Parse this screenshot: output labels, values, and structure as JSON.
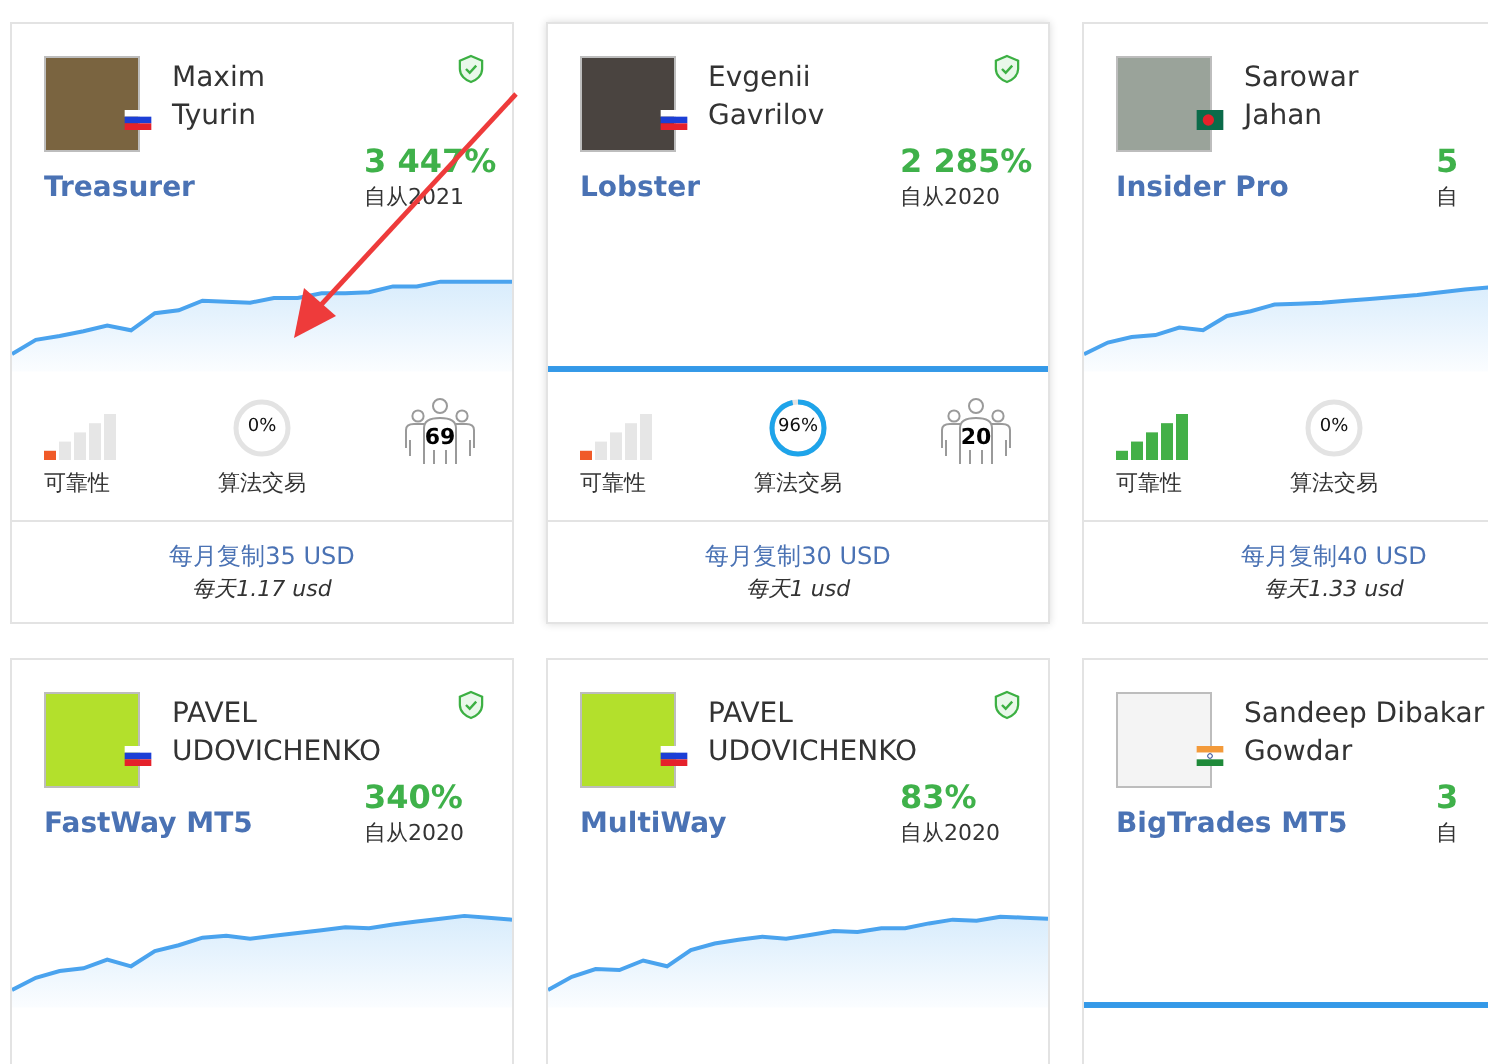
{
  "rows": [
    {
      "cards": [
        {
          "author_lines": [
            "Maxim",
            "Tyurin"
          ],
          "flag": {
            "kind": "ru"
          },
          "avatar": {
            "color": "#7a6440"
          },
          "verified": true,
          "strategy": "Treasurer",
          "gain": "3 447%",
          "since": "自从2021",
          "chart": {
            "kind": "rising"
          },
          "stats": {
            "reliability": {
              "level": 0.2,
              "label": "可靠性"
            },
            "algo": {
              "level": 0,
              "reading": "0%",
              "label": "算法交易"
            },
            "subscribers": "69"
          },
          "price": "每月复制35 USD",
          "daily": "每天1.17 usd"
        },
        {
          "author_lines": [
            "Evgenii",
            "Gavrilov"
          ],
          "flag": {
            "kind": "ru"
          },
          "avatar": {
            "color": "#4a4440"
          },
          "verified": true,
          "strategy": "Lobster",
          "gain": "2 285%",
          "since": "自从2020",
          "chart": {
            "kind": "flat"
          },
          "stats": {
            "reliability": {
              "level": 0.2,
              "label": "可靠性"
            },
            "algo": {
              "level": 0.96,
              "reading": "96%",
              "label": "算法交易"
            },
            "subscribers": "20"
          },
          "price": "每月复制30 USD",
          "daily": "每天1 usd"
        },
        {
          "author_lines": [
            "Sarowar",
            "Jahan"
          ],
          "flag": {
            "kind": "bd"
          },
          "avatar": {
            "color": "#9aa39a"
          },
          "strategy": "Insider Pro",
          "gain": "5",
          "since": "自",
          "chart": {
            "kind": "rising"
          },
          "stats": {
            "reliability": {
              "level": 1,
              "label": "可靠性"
            },
            "algo": {
              "level": 0,
              "reading": "0%",
              "label": "算法交易"
            }
          },
          "price": "每月复制40 USD",
          "daily": "每天1.33 usd"
        }
      ]
    },
    {
      "cards": [
        {
          "author_lines": [
            "PAVEL",
            "UDOVICHENKO"
          ],
          "flag": {
            "kind": "ru"
          },
          "avatar": {
            "color": "#b3e02c"
          },
          "verified": true,
          "strategy": "FastWay MT5",
          "gain": "340%",
          "since": "自从2020",
          "chart": {
            "kind": "rising"
          }
        },
        {
          "author_lines": [
            "PAVEL",
            "UDOVICHENKO"
          ],
          "flag": {
            "kind": "ru"
          },
          "avatar": {
            "color": "#b3e02c"
          },
          "verified": true,
          "strategy": "MultiWay",
          "gain": "83%",
          "since": "自从2020",
          "chart": {
            "kind": "rising"
          }
        },
        {
          "author_lines": [
            "Sandeep Dibakar",
            "Gowdar"
          ],
          "flag": {
            "kind": "in"
          },
          "avatar": {
            "color": "#f4f4f4"
          },
          "strategy": "BigTrades MT5",
          "gain": "3",
          "since": "自",
          "chart": {
            "kind": "flat"
          }
        }
      ]
    }
  ]
}
